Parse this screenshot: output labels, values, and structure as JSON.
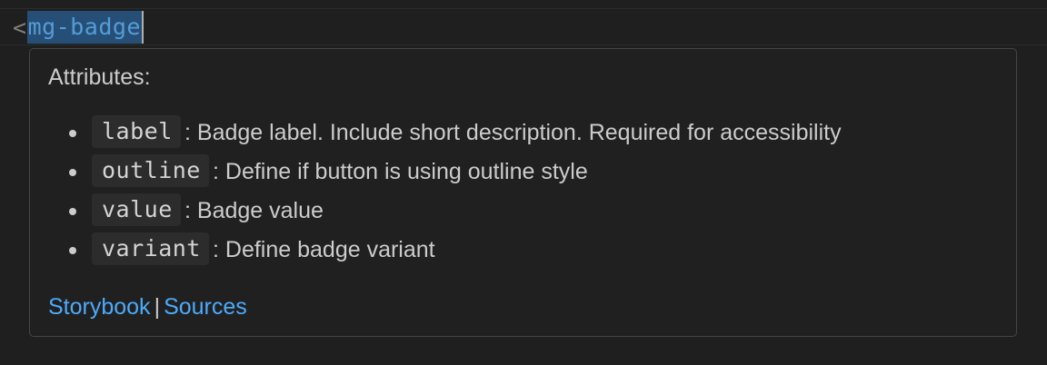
{
  "editor": {
    "bracket": "<",
    "tag_name": "mg-badge"
  },
  "hover": {
    "heading": "Attributes:",
    "attributes": [
      {
        "name": "label",
        "description": ": Badge label. Include short description. Required for accessibility"
      },
      {
        "name": "outline",
        "description": ": Define if button is using outline style"
      },
      {
        "name": "value",
        "description": ": Badge value"
      },
      {
        "name": "variant",
        "description": ": Define badge variant"
      }
    ],
    "links": {
      "storybook": "Storybook",
      "separator": "|",
      "sources": "Sources"
    }
  },
  "colors": {
    "background": "#1f1f1f",
    "tag_name": "#569cd6",
    "link": "#4daafc",
    "selection": "#264f78"
  }
}
